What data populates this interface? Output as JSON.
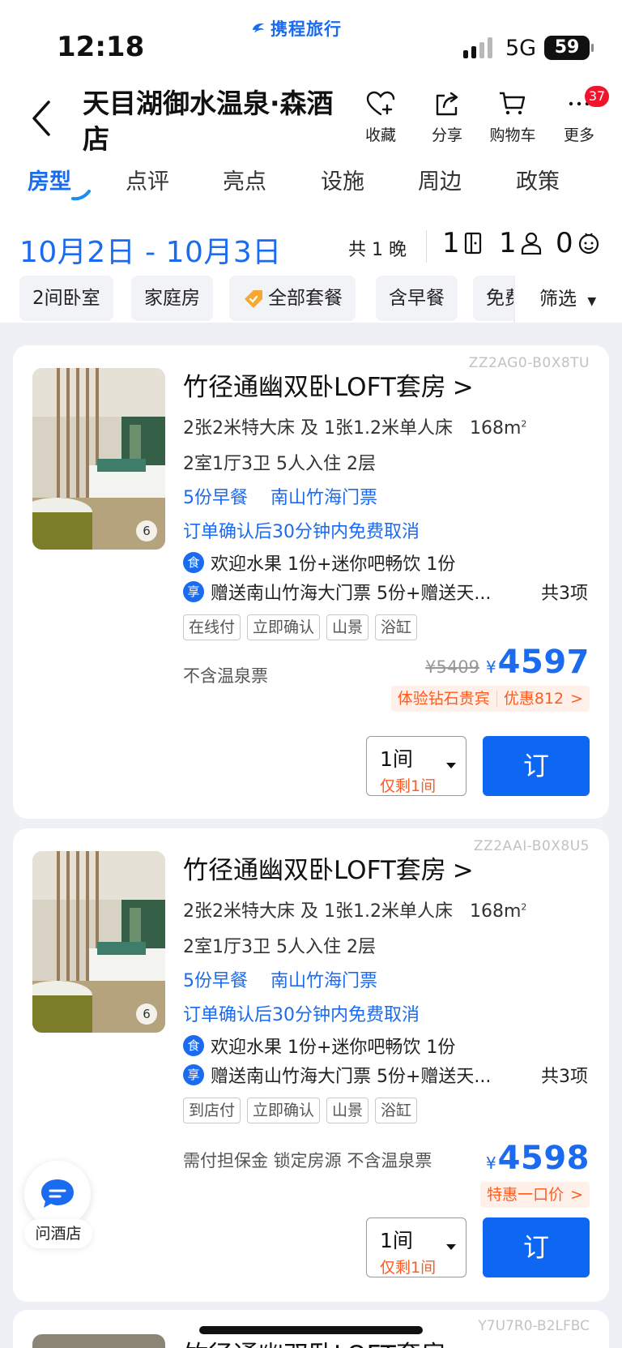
{
  "status": {
    "time": "12:18",
    "network": "5G",
    "battery": "59"
  },
  "brand": {
    "name": "携程旅行",
    "color": "#1a6bf0"
  },
  "header": {
    "title": "天目湖御水温泉·森酒店",
    "actions": [
      {
        "label": "收藏",
        "icon": "heart-plus-icon"
      },
      {
        "label": "分享",
        "icon": "share-icon"
      },
      {
        "label": "购物车",
        "icon": "cart-icon"
      },
      {
        "label": "更多",
        "icon": "more-icon"
      }
    ],
    "more_badge": "37"
  },
  "tabs": [
    {
      "label": "房型",
      "active": true
    },
    {
      "label": "点评"
    },
    {
      "label": "亮点"
    },
    {
      "label": "设施"
    },
    {
      "label": "周边"
    },
    {
      "label": "政策"
    }
  ],
  "stay": {
    "date_range": "10月2日 - 10月3日",
    "nights": "共 1 晚",
    "rooms": "1",
    "adults": "1",
    "children": "0"
  },
  "filters": {
    "chips": [
      "2间卧室",
      "家庭房",
      "全部套餐",
      "含早餐",
      "免费"
    ],
    "filter_label": "筛选"
  },
  "rooms": [
    {
      "code": "ZZ2AG0-B0X8TU",
      "name": "竹径通幽双卧LOFT套房",
      "photo_count": "6",
      "beds": "2张2米特大床 及 1张1.2米单人床",
      "area": "168m",
      "layout": "2室1厅3卫   5人入住   2层",
      "meal": "5份早餐",
      "ticket": "南山竹海门票",
      "cancel": "订单确认后30分钟内免费取消",
      "gift1_icon": "食",
      "gift1": "欢迎水果 1份+迷你吧畅饮 1份",
      "gift2_icon": "享",
      "gift2": "赠送南山竹海大门票 5份+赠送天...",
      "gift2_total": "共3项",
      "tags": [
        "在线付",
        "立即确认",
        "山景",
        "浴缸"
      ],
      "note": "不含温泉票",
      "orig_price": "¥5409",
      "currency": "¥",
      "price": "4597",
      "promo1": "体验钻石贵宾",
      "promo2": "优惠812",
      "qty": "1间",
      "qty_left": "仅剩1间",
      "book": "订"
    },
    {
      "code": "ZZ2AAI-B0X8U5",
      "name": "竹径通幽双卧LOFT套房",
      "photo_count": "6",
      "beds": "2张2米特大床 及 1张1.2米单人床",
      "area": "168m",
      "layout": "2室1厅3卫   5人入住   2层",
      "meal": "5份早餐",
      "ticket": "南山竹海门票",
      "cancel": "订单确认后30分钟内免费取消",
      "gift1_icon": "食",
      "gift1": "欢迎水果 1份+迷你吧畅饮 1份",
      "gift2_icon": "享",
      "gift2": "赠送南山竹海大门票 5份+赠送天...",
      "gift2_total": "共3项",
      "tags": [
        "到店付",
        "立即确认",
        "山景",
        "浴缸"
      ],
      "note": "需付担保金  锁定房源  不含温泉票",
      "currency": "¥",
      "price": "4598",
      "promo1": "特惠一口价",
      "qty": "1间",
      "qty_left": "仅剩1间",
      "book": "订"
    },
    {
      "code": "Y7U7R0-B2LFBC",
      "name": "竹径通幽双卧LOFT套房"
    }
  ],
  "ask_hotel": {
    "label": "问酒店"
  }
}
